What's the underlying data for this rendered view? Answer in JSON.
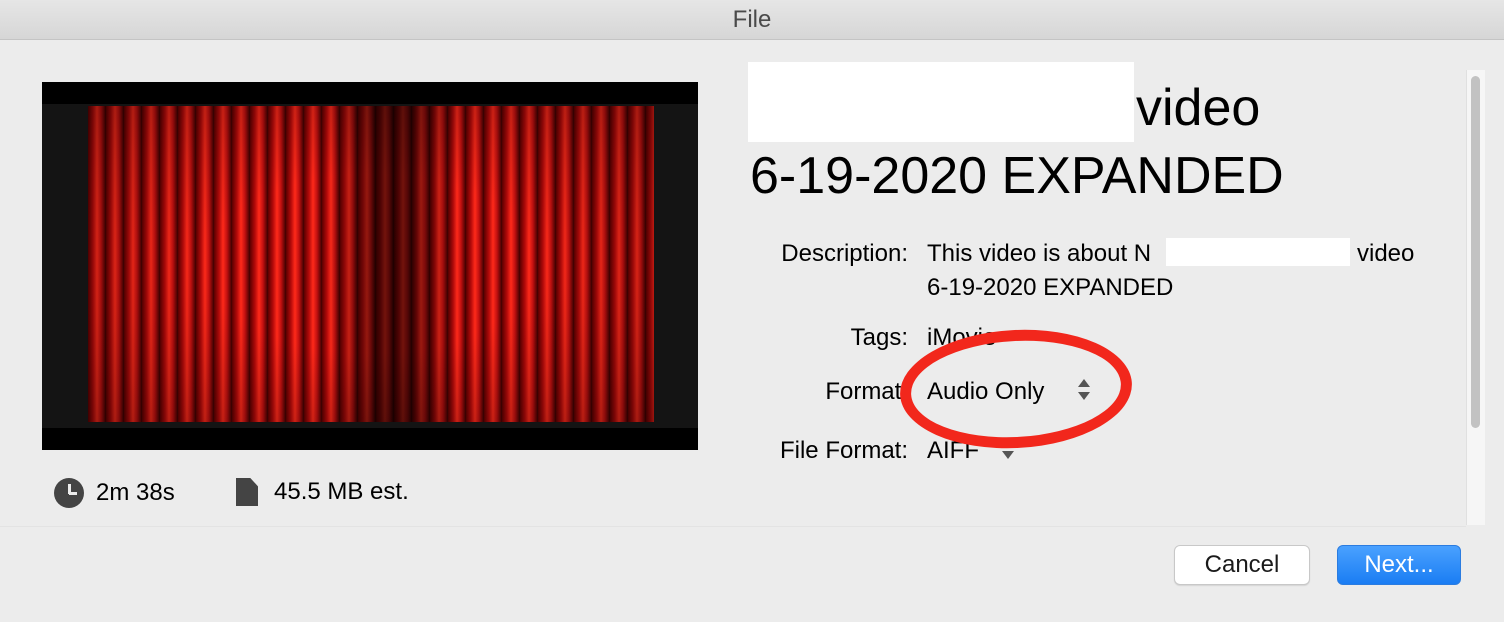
{
  "window": {
    "title": "File"
  },
  "preview": {
    "thumbnail": "red-theater-curtain"
  },
  "stats": {
    "duration": "2m 38s",
    "duration_icon": "clock-icon",
    "size": "45.5 MB est.",
    "size_icon": "document-icon"
  },
  "project": {
    "title_line1_suffix": "video",
    "title_line2": "6-19-2020  EXPANDED"
  },
  "fields": {
    "description_label": "Description:",
    "description_line1_prefix": "This video is about N",
    "description_line1_suffix": "video",
    "description_line2": "6-19-2020  EXPANDED",
    "tags_label": "Tags:",
    "tags_value": "iMovie",
    "format_label": "Format:",
    "format_value": "Audio Only",
    "file_format_label": "File Format:",
    "file_format_value": "AIFF"
  },
  "buttons": {
    "cancel": "Cancel",
    "next": "Next..."
  },
  "colors": {
    "accent": "#1a7df3",
    "annotation": "#f2271c"
  }
}
